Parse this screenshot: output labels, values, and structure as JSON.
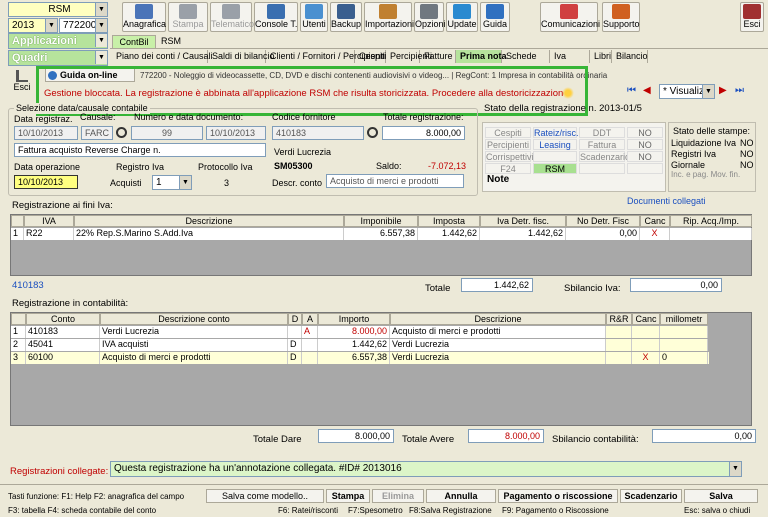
{
  "top": {
    "company": "RSM",
    "year": "2013",
    "code": "772200 -",
    "apps": "Applicazioni",
    "panels": "Quadri"
  },
  "toolbar": [
    {
      "label": "Anagrafica",
      "enabled": true,
      "icon": "id-card-icon",
      "color": "#4a74b8"
    },
    {
      "label": "Stampa",
      "enabled": false,
      "icon": "printer-icon",
      "color": "#9aa0a8"
    },
    {
      "label": "Telematico",
      "enabled": false,
      "icon": "network-icon",
      "color": "#9aa0a8"
    },
    {
      "label": "Console T.",
      "enabled": true,
      "icon": "console-icon",
      "color": "#3a6fb0"
    },
    {
      "label": "Utenti",
      "enabled": true,
      "icon": "users-icon",
      "color": "#4a90d0"
    },
    {
      "label": "Backup",
      "enabled": true,
      "icon": "backup-icon",
      "color": "#3a5f8f"
    },
    {
      "label": "Importazioni",
      "enabled": true,
      "icon": "import-icon",
      "color": "#c08030"
    },
    {
      "label": "Opzioni",
      "enabled": true,
      "icon": "options-icon",
      "color": "#707880"
    },
    {
      "label": "Update",
      "enabled": true,
      "icon": "update-icon",
      "color": "#2a8ad0"
    },
    {
      "label": "Guida",
      "enabled": true,
      "icon": "help-icon",
      "color": "#3070c0"
    },
    {
      "label": "Comunicazioni",
      "enabled": true,
      "icon": "communications-icon",
      "color": "#d04040"
    },
    {
      "label": "Supporto",
      "enabled": true,
      "icon": "support-icon",
      "color": "#d06020"
    },
    {
      "label": "Esci",
      "enabled": true,
      "icon": "exit-icon",
      "color": "#a03030"
    }
  ],
  "tabs": [
    "ContBil",
    "RSM"
  ],
  "menu": [
    "Piano dei conti / Causali",
    "Saldi di bilancio",
    "Clienti / Fornitori / Percipienti",
    "Cespiti",
    "Percipienti",
    "Fatture",
    "Prima nota",
    "Schede",
    "Iva",
    "Libri",
    "Bilancio"
  ],
  "infobar": {
    "esci": "Esci",
    "guide": "Guida on-line",
    "company_info": "772200 - Noleggio di videocassette, CD, DVD e dischi contenenti audiovisivi o videog... | RegCont: 1 Impresa in contabilità ordinaria",
    "warning": "Gestione bloccata. La registrazione è abbinata all'applicazione RSM che risulta storicizzata. Procedere alla destoricizzazione.",
    "view": "* Visualiz"
  },
  "form": {
    "section": "Selezione data/causale contabile",
    "date_label": "Data registraz.",
    "date": "10/10/2013",
    "causale_label": "Causale:",
    "causale": "FARC",
    "docnum_label": "Numero e data documento:",
    "docnum": "99",
    "docdate": "10/10/2013",
    "supplier_label": "Codice fornitore",
    "supplier": "410183",
    "total_label": "Totale registrazione:",
    "total": "8.000,00",
    "description": "Fattura acquisto Reverse Charge n.",
    "supplier_name": "Verdi Lucrezia",
    "supplier_code": "SM05300",
    "saldo_label": "Saldo:",
    "saldo": "-7.072,13",
    "opdate_label": "Data operazione",
    "opdate": "10/10/2013",
    "regiva_label": "Registro Iva",
    "regiva_type": "Acquisti",
    "regiva": "1",
    "protocol_label": "Protocollo Iva",
    "protocol": "3",
    "descconto_label": "Descr. conto",
    "descconto": "Acquisto di merci e prodotti"
  },
  "status": {
    "title": "Stato della registrazione n. 2013-01/5",
    "rows": [
      [
        "Cespiti",
        "Rateiz/risc.",
        "DDT",
        "NO"
      ],
      [
        "Percipienti",
        "Leasing",
        "Fattura",
        "NO"
      ],
      [
        "Corrispettivi",
        "",
        "Scadenzario",
        "NO"
      ],
      [
        "F24",
        "RSM",
        "",
        ""
      ]
    ],
    "note": "Note",
    "prints_title": "Stato delle stampe:",
    "prints": [
      [
        "Liquidazione Iva",
        "NO"
      ],
      [
        "Registri Iva",
        "NO"
      ],
      [
        "Giornale",
        "NO"
      ],
      [
        "Inc. e pag. Mov. fin.",
        ""
      ]
    ],
    "linked_docs": "Documenti collegati"
  },
  "iva": {
    "title": "Registrazione ai fini Iva:",
    "headers": [
      "IVA",
      "Descrizione",
      "Imponibile",
      "Imposta",
      "Iva Detr. fisc.",
      "No Detr. Fisc",
      "Canc",
      "Rip. Acq./Imp."
    ],
    "rows": [
      {
        "n": "1",
        "iva": "R22",
        "desc": "22% Rep.S.Marino S.Add.Iva",
        "imponibile": "6.557,38",
        "imposta": "1.442,62",
        "detr": "1.442,62",
        "nodetr": "0,00",
        "canc": "X",
        "rip": ""
      }
    ],
    "footer_code": "410183",
    "total_label": "Totale",
    "total": "1.442,62",
    "unbalance_label": "Sbilancio Iva:",
    "unbalance": "0,00"
  },
  "acc": {
    "title": "Registrazione in contabilità:",
    "headers": [
      "Conto",
      "Descrizione conto",
      "D",
      "A",
      "Importo",
      "Descrizione",
      "R&R",
      "Canc",
      "millometr"
    ],
    "rows": [
      {
        "n": "1",
        "conto": "410183",
        "desc": "Verdi Lucrezia",
        "d": "",
        "a": "A",
        "importo": "8.000,00",
        "descr": "Acquisto di merci e prodotti",
        "rr": "",
        "canc": "",
        "milli": ""
      },
      {
        "n": "2",
        "conto": "45041",
        "desc": "IVA acquisti",
        "d": "D",
        "a": "",
        "importo": "1.442,62",
        "descr": "Verdi Lucrezia",
        "rr": "",
        "canc": "",
        "milli": ""
      },
      {
        "n": "3",
        "conto": "60100",
        "desc": "Acquisto di merci e prodotti",
        "d": "D",
        "a": "",
        "importo": "6.557,38",
        "descr": "Verdi Lucrezia",
        "rr": "",
        "canc": "X",
        "milli": "0"
      }
    ],
    "dare_label": "Totale Dare",
    "dare": "8.000,00",
    "avere_label": "Totale Avere",
    "avere": "8.000,00",
    "unbalance_label": "Sbilancio contabilità:",
    "unbalance": "0,00"
  },
  "linked": {
    "label": "Registrazioni collegate:",
    "value": "Questa registrazione ha un'annotazione collegata. #ID# 2013016"
  },
  "footer": {
    "keys1": "Tasti funzione: F1: Help  F2: anagrafica del campo",
    "keys2": "F3: tabella   F4: scheda contabile del conto",
    "buttons": [
      {
        "label": "Salva come modello..",
        "hotkey": "",
        "style": "norm"
      },
      {
        "label": "Stampa",
        "hotkey": "",
        "style": "bold"
      },
      {
        "label": "Elimina",
        "hotkey": "",
        "style": "dis"
      },
      {
        "label": "Annulla",
        "hotkey": "",
        "style": "bold"
      },
      {
        "label": "Pagamento o riscossione",
        "hotkey": "F9: Pagamento o Riscossione",
        "style": "bold"
      },
      {
        "label": "Scadenzario",
        "hotkey": "",
        "style": "bold"
      },
      {
        "label": "Salva",
        "hotkey": "Esc: salva o chiudi",
        "style": "bold"
      }
    ],
    "hot_f6": "F6: Ratei/risconti",
    "hot_f7": "F7:Spesometro",
    "hot_f8": "F8:Salva Registrazione"
  },
  "colors": {
    "accent_green": "#37b537",
    "warning_red": "#c00000",
    "yellow": "#ffff80",
    "light_yellow": "#ffffd8"
  }
}
